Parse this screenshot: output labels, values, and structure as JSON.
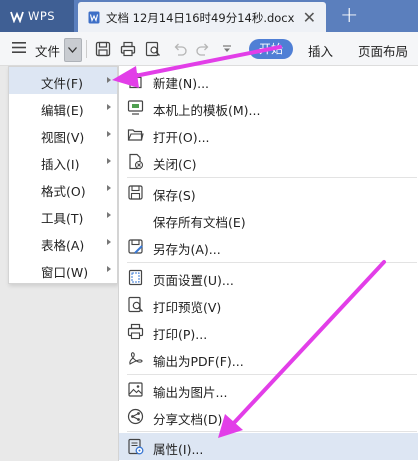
{
  "tabs": {
    "app_label": "WPS",
    "doc_label": "文档 12月14日16时49分14秒.docx",
    "close_glyph": "✕",
    "new_tab_glyph": "+"
  },
  "toolbar": {
    "file_label": "文件",
    "start_label": "开始",
    "insert_label": "插入",
    "layout_label": "页面布局"
  },
  "main_menu": [
    {
      "label": "文件(F)",
      "has_sub": true,
      "active": true
    },
    {
      "label": "编辑(E)",
      "has_sub": true
    },
    {
      "label": "视图(V)",
      "has_sub": true
    },
    {
      "label": "插入(I)",
      "has_sub": true
    },
    {
      "label": "格式(O)",
      "has_sub": true
    },
    {
      "label": "工具(T)",
      "has_sub": true
    },
    {
      "label": "表格(A)",
      "has_sub": true
    },
    {
      "label": "窗口(W)",
      "has_sub": true
    }
  ],
  "file_menu": [
    {
      "label": "新建(N)...",
      "icon": "new-document-icon"
    },
    {
      "label": "本机上的模板(M)...",
      "icon": "template-icon"
    },
    {
      "label": "打开(O)...",
      "icon": "open-folder-icon"
    },
    {
      "label": "关闭(C)",
      "icon": "close-document-icon"
    },
    {
      "label": "保存(S)",
      "icon": "save-icon"
    },
    {
      "label": "保存所有文档(E)",
      "icon": ""
    },
    {
      "label": "另存为(A)...",
      "icon": "save-as-icon"
    },
    {
      "label": "页面设置(U)...",
      "icon": "page-setup-icon"
    },
    {
      "label": "打印预览(V)",
      "icon": "print-preview-icon"
    },
    {
      "label": "打印(P)...",
      "icon": "print-icon"
    },
    {
      "label": "输出为PDF(F)...",
      "icon": "export-pdf-icon"
    },
    {
      "label": "输出为图片...",
      "icon": "export-image-icon"
    },
    {
      "label": "分享文档(D)",
      "icon": "share-icon"
    },
    {
      "label": "属性(I)...",
      "icon": "properties-icon",
      "active": true
    }
  ],
  "colors": {
    "tabbar": "#5b7fbd",
    "accent": "#4f7fd5",
    "highlight": "#dde6f3",
    "annotation_arrow": "#e23ee8"
  }
}
